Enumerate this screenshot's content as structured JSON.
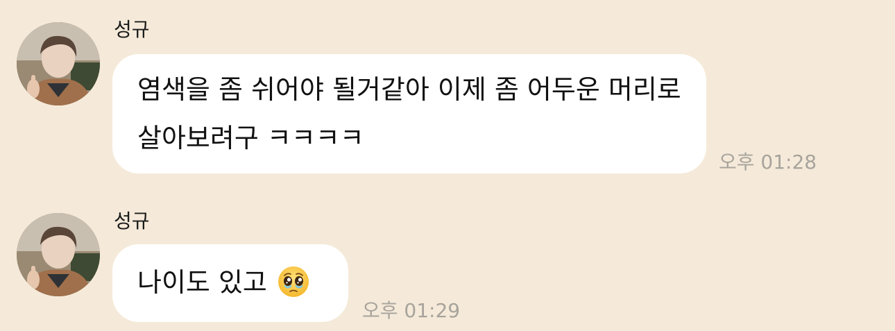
{
  "chat": {
    "messages": [
      {
        "sender": "성규",
        "avatar_icon": "profile-photo",
        "text": "염색을 좀 쉬어야 될거같아 이제 좀 어두운 머리로 살아보려구 ㅋㅋㅋㅋ",
        "time": "오후 01:28"
      },
      {
        "sender": "성규",
        "avatar_icon": "profile-photo",
        "text": "나이도 있고",
        "emoji": "pleading-face-icon",
        "time": "오후 01:29"
      }
    ]
  },
  "colors": {
    "background": "#f5ead9",
    "bubble": "#ffffff",
    "timestamp": "#a7a39c"
  }
}
